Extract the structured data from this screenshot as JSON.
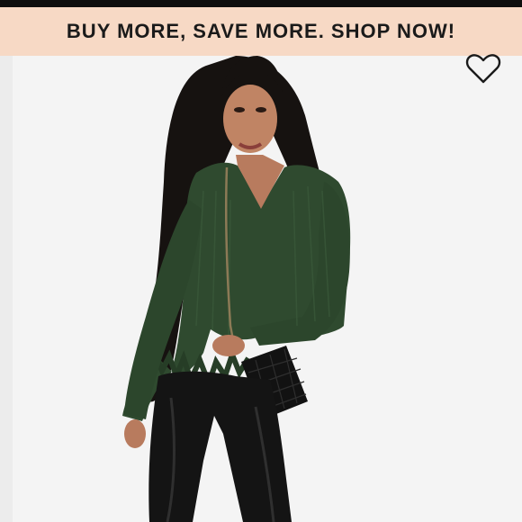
{
  "promo": {
    "text": "BUY MORE, SAVE MORE. SHOP NOW!"
  },
  "product_image": {
    "subject": "model wearing green distressed knit v-neck sweater, black leather leggings and black quilted crossbody bag"
  },
  "favorite": {
    "icon": "heart-outline-icon"
  },
  "colors": {
    "banner_bg": "#f7d9c5",
    "banner_text": "#1a1a1a",
    "sweater": "#2f4a2f",
    "leggings": "#141414",
    "background": "#f4f4f4"
  }
}
